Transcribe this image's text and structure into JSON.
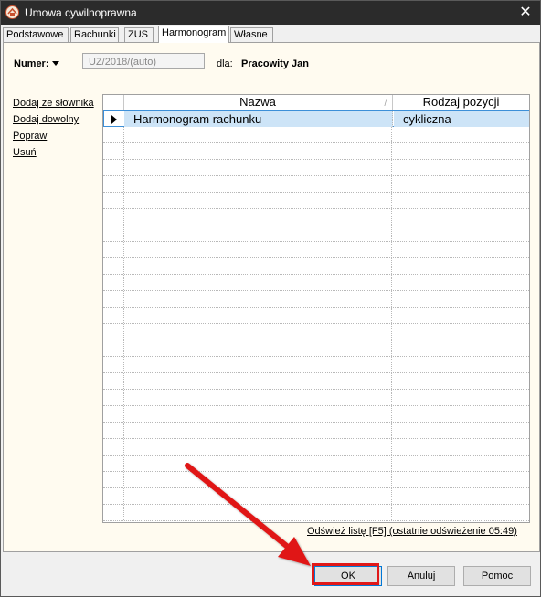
{
  "window": {
    "title": "Umowa cywilnoprawna",
    "close_glyph": "✕"
  },
  "tabs": [
    {
      "label": "Podstawowe"
    },
    {
      "label": "Rachunki"
    },
    {
      "label": "ZUS"
    },
    {
      "label": "Harmonogram",
      "active": true
    },
    {
      "label": "Własne"
    }
  ],
  "numer": {
    "label": "Numer:",
    "value": "UZ/2018/(auto)"
  },
  "dla": {
    "label": "dla:",
    "value": "Pracowity Jan"
  },
  "side_links": [
    "Dodaj ze słownika",
    "Dodaj dowolny",
    "Popraw",
    "Usuń"
  ],
  "grid": {
    "columns": [
      "Nazwa",
      "Rodzaj pozycji"
    ],
    "rows": [
      {
        "nazwa": "Harmonogram rachunku",
        "rodzaj": "cykliczna",
        "selected": true
      }
    ]
  },
  "refresh_text": "Odśwież listę [F5] (ostatnie odświeżenie 05:49)",
  "buttons": {
    "ok": "OK",
    "anuluj": "Anuluj",
    "pomoc": "Pomoc"
  },
  "colors": {
    "titlebar": "#2b2b2b",
    "selection": "#cde4f7",
    "annotation": "#e01818"
  }
}
